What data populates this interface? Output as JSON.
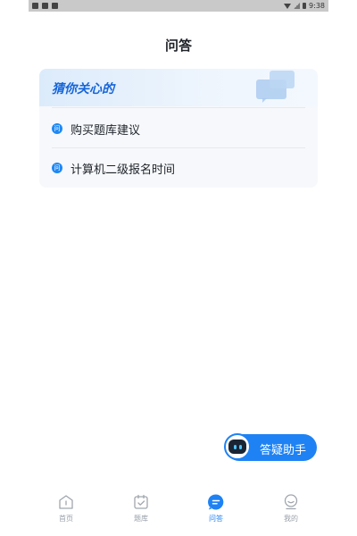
{
  "status_bar": {
    "time": "9:38"
  },
  "header": {
    "title": "问答"
  },
  "card": {
    "title": "猜你关心的",
    "questions": [
      {
        "icon": "问",
        "label": "购买题库建议"
      },
      {
        "icon": "问",
        "label": "计算机二级报名时间"
      }
    ]
  },
  "assistant": {
    "label": "答疑助手"
  },
  "tabbar": {
    "active": "问答",
    "items": [
      {
        "label": "首页",
        "icon": "home-icon"
      },
      {
        "label": "题库",
        "icon": "question-bank-icon"
      },
      {
        "label": "问答",
        "icon": "qa-icon"
      },
      {
        "label": "我的",
        "icon": "profile-icon"
      }
    ]
  },
  "colors": {
    "accent": "#1e82f4",
    "card_bg": "#f6f8fb",
    "inactive": "#9aa0a8"
  }
}
